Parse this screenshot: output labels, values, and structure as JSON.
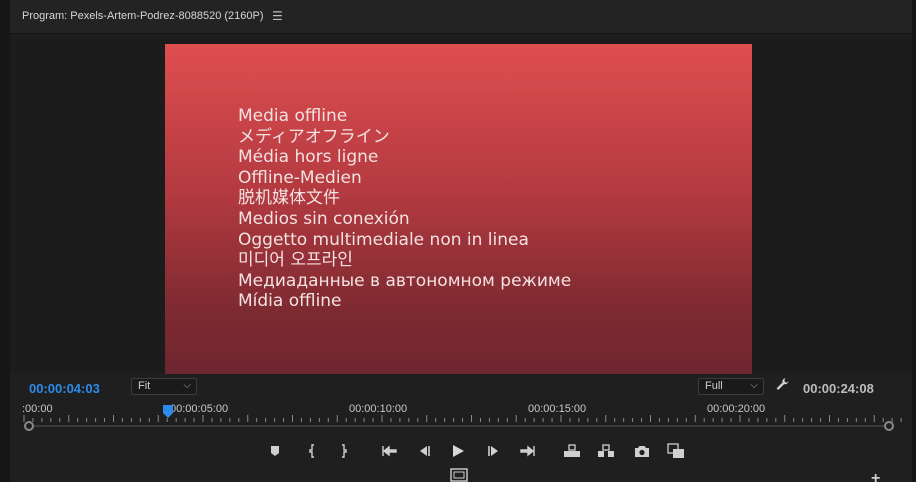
{
  "panel": {
    "title": "Program: Pexels-Artem-Podrez-8088520 (2160P)",
    "menu_icon": "hamburger-menu-icon"
  },
  "monitor": {
    "offline_lines": [
      "Media offline",
      "メディアオフライン",
      "Média hors ligne",
      "Offline-Medien",
      "脱机媒体文件",
      "Medios sin conexión",
      "Oggetto multimediale non in linea",
      "미디어 오프라인",
      "Медиаданные в автономном режиме",
      "Mídia offline"
    ],
    "gradient_top": "#df4e50",
    "gradient_bottom": "#6e2630"
  },
  "controls": {
    "current_timecode": "00:00:04:03",
    "current_timecode_color": "#2d8ceb",
    "zoom_value": "Fit",
    "quality_value": "Full",
    "total_timecode": "00:00:24:08",
    "settings_icon": "wrench-icon"
  },
  "ruler": {
    "labels": [
      ":00:00",
      "00:00:05:00",
      "00:00:10:00",
      "00:00:15:00",
      "00:00:20:00"
    ]
  },
  "transport": {
    "buttons": [
      {
        "name": "add-marker-button",
        "icon": "marker-icon"
      },
      {
        "name": "mark-in-button",
        "icon": "mark-in-icon"
      },
      {
        "name": "mark-out-button",
        "icon": "mark-out-icon"
      },
      {
        "name": "go-to-in-button",
        "icon": "go-to-in-icon"
      },
      {
        "name": "step-back-button",
        "icon": "step-back-icon"
      },
      {
        "name": "play-button",
        "icon": "play-icon"
      },
      {
        "name": "step-forward-button",
        "icon": "step-forward-icon"
      },
      {
        "name": "go-to-out-button",
        "icon": "go-to-out-icon"
      },
      {
        "name": "lift-button",
        "icon": "lift-icon"
      },
      {
        "name": "extract-button",
        "icon": "extract-icon"
      },
      {
        "name": "export-frame-button",
        "icon": "camera-icon"
      },
      {
        "name": "compare-view-button",
        "icon": "compare-icon"
      }
    ]
  }
}
